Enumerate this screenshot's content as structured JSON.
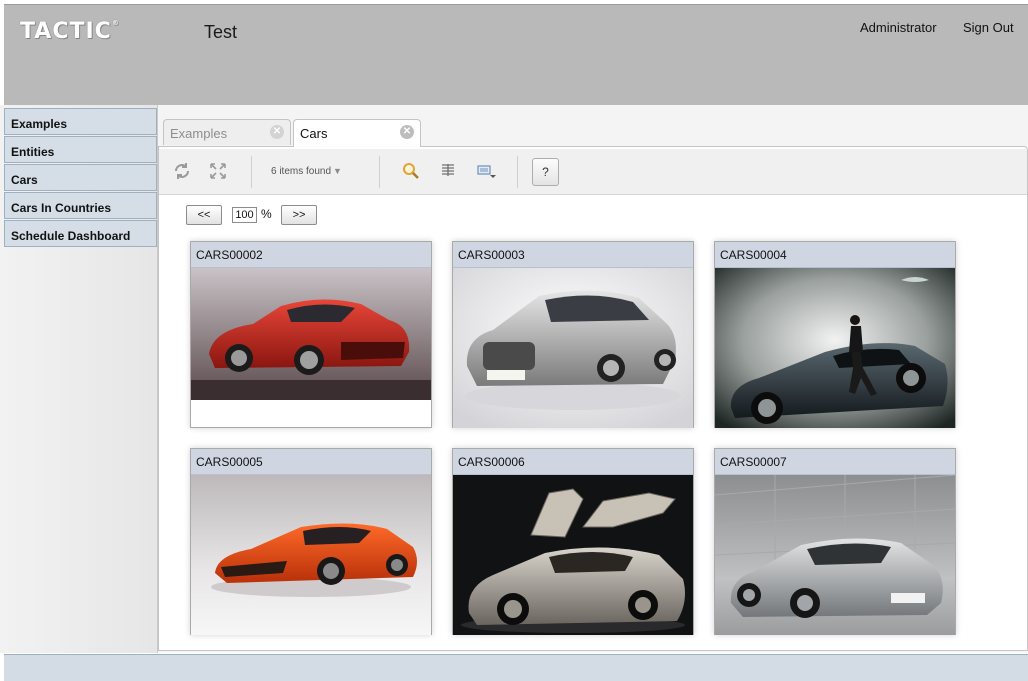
{
  "header": {
    "logo": "TACTIC",
    "logo_mark": "®",
    "project_title": "Test",
    "user_label": "Administrator",
    "sign_out_label": "Sign Out"
  },
  "sidebar": {
    "items": [
      {
        "label": "Examples"
      },
      {
        "label": "Entities"
      },
      {
        "label": "Cars"
      },
      {
        "label": "Cars In Countries"
      },
      {
        "label": "Schedule Dashboard"
      }
    ]
  },
  "tabs": [
    {
      "label": "Examples",
      "active": false
    },
    {
      "label": "Cars",
      "active": true
    }
  ],
  "toolbar": {
    "items_found": "6 items found",
    "refresh_icon": "refresh-icon",
    "expand_icon": "expand-icon",
    "search_icon": "search-icon",
    "columns_icon": "column-manager-icon",
    "view_icon": "view-mode-icon",
    "help_label": "?"
  },
  "zoom": {
    "prev_label": "<<",
    "next_label": ">>",
    "value": "100",
    "unit": "%"
  },
  "cards": [
    {
      "code": "CARS00002",
      "thumb": "red-sports-car"
    },
    {
      "code": "CARS00003",
      "thumb": "silver-grand-tourer"
    },
    {
      "code": "CARS00004",
      "thumb": "dark-coupe-with-model"
    },
    {
      "code": "CARS00005",
      "thumb": "orange-supercar"
    },
    {
      "code": "CARS00006",
      "thumb": "silver-gullwing-supercar"
    },
    {
      "code": "CARS00007",
      "thumb": "silver-911-coupe"
    }
  ],
  "colors": {
    "header_bg": "#b9b9b9",
    "sidebar_item_bg": "#d5dde6",
    "card_header_bg": "#cfd6e2"
  }
}
